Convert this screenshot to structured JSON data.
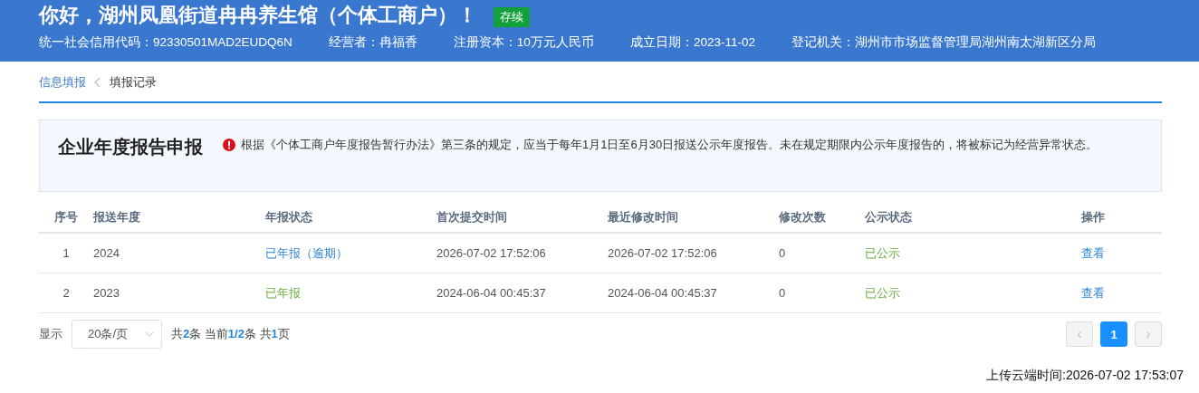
{
  "header": {
    "greeting": "你好，湖州凤凰街道冉冉养生馆（个体工商户）！",
    "status_badge": "存续",
    "info": [
      {
        "label": "统一社会信用代码：",
        "value": "92330501MAD2EUDQ6N"
      },
      {
        "label": "经营者：",
        "value": "冉福香"
      },
      {
        "label": "注册资本：",
        "value": "10万元人民币"
      },
      {
        "label": "成立日期：",
        "value": "2023-11-02"
      },
      {
        "label": "登记机关：",
        "value": "湖州市市场监督管理局湖州南太湖新区分局"
      }
    ]
  },
  "breadcrumb": [
    {
      "label": "信息填报",
      "kind": "link"
    },
    {
      "label": "填报记录",
      "kind": "current"
    }
  ],
  "notice": {
    "title": "企业年度报告申报",
    "text": "根据《个体工商户年度报告暂行办法》第三条的规定，应当于每年1月1日至6月30日报送公示年度报告。未在规定期限内公示年度报告的，将被标记为经营异常状态。"
  },
  "table": {
    "columns": [
      "序号",
      "报送年度",
      "年报状态",
      "首次提交时间",
      "最近修改时间",
      "修改次数",
      "公示状态",
      "操作"
    ],
    "rows": [
      {
        "index": "1",
        "year": "2024",
        "status": {
          "text": "已年报（逾期）",
          "color": "#2f86d8"
        },
        "first_submitted": "2026-07-02 17:52:06",
        "last_modified": "2026-07-02 17:52:06",
        "edit_count": "0",
        "publicity": "已公示",
        "action": "查看"
      },
      {
        "index": "2",
        "year": "2023",
        "status": {
          "text": "已年报",
          "color": "#6aae3e"
        },
        "first_submitted": "2024-06-04 00:45:37",
        "last_modified": "2024-06-04 00:45:37",
        "edit_count": "0",
        "publicity": "已公示",
        "action": "查看"
      }
    ]
  },
  "pagination": {
    "show_label": "显示",
    "page_size": "20条/页",
    "summary": "共**2**条 当前**1/2**条 共**1**页",
    "prev": {
      "label": "‹",
      "disabled": true
    },
    "pages": [
      {
        "label": "1",
        "selected": true
      }
    ],
    "next": {
      "label": "›",
      "disabled": true
    }
  },
  "footer": {
    "upload_time": "上传云端时间:2026-07-02 17:53:07"
  }
}
